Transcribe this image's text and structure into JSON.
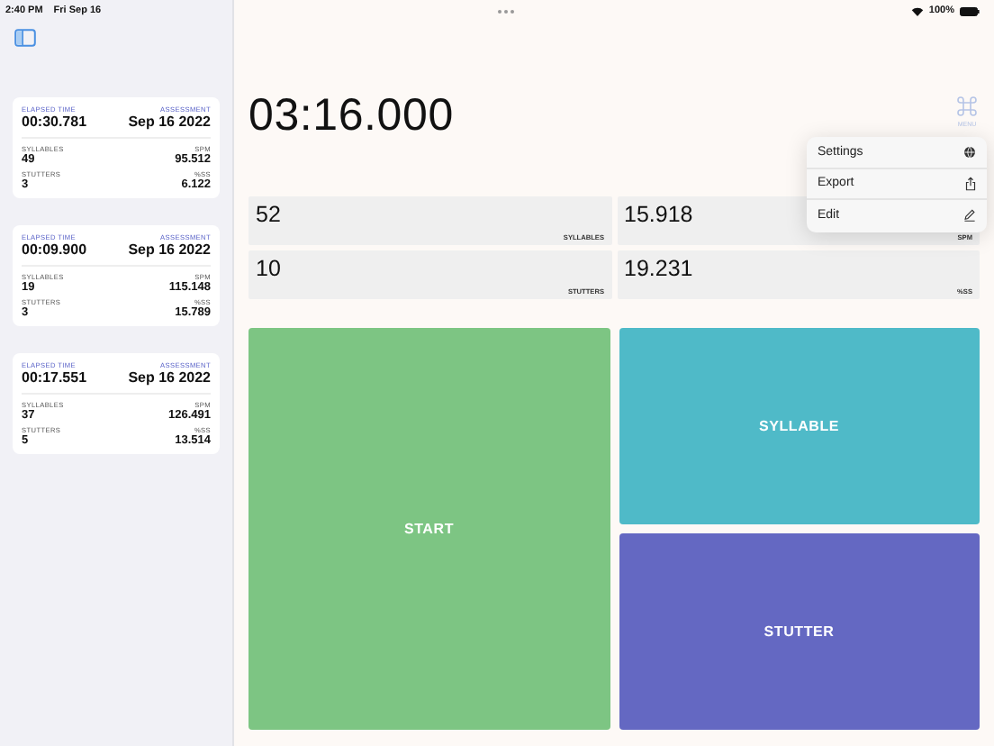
{
  "status_bar": {
    "time": "2:40 PM",
    "date": "Fri Sep 16",
    "battery": "100%"
  },
  "sessions": [
    {
      "elapsed_label": "ELAPSED TIME",
      "elapsed": "00:30.781",
      "assessment_label": "ASSESSMENT",
      "date": "Sep 16 2022",
      "syllables_label": "SYLLABLES",
      "syllables": "49",
      "spm_label": "SPM",
      "spm": "95.512",
      "stutters_label": "STUTTERS",
      "stutters": "3",
      "pss_label": "%SS",
      "pss": "6.122"
    },
    {
      "elapsed_label": "ELAPSED TIME",
      "elapsed": "00:09.900",
      "assessment_label": "ASSESSMENT",
      "date": "Sep 16 2022",
      "syllables_label": "SYLLABLES",
      "syllables": "19",
      "spm_label": "SPM",
      "spm": "115.148",
      "stutters_label": "STUTTERS",
      "stutters": "3",
      "pss_label": "%SS",
      "pss": "15.789"
    },
    {
      "elapsed_label": "ELAPSED TIME",
      "elapsed": "00:17.551",
      "assessment_label": "ASSESSMENT",
      "date": "Sep 16 2022",
      "syllables_label": "SYLLABLES",
      "syllables": "37",
      "spm_label": "SPM",
      "spm": "126.491",
      "stutters_label": "STUTTERS",
      "stutters": "5",
      "pss_label": "%SS",
      "pss": "13.514"
    }
  ],
  "timer": "03:16.000",
  "menu_button": {
    "label": "MENU"
  },
  "stats": [
    {
      "value": "52",
      "label": "SYLLABLES"
    },
    {
      "value": "15.918",
      "label": "SPM"
    },
    {
      "value": "10",
      "label": "STUTTERS"
    },
    {
      "value": "19.231",
      "label": "%SS"
    }
  ],
  "actions": [
    {
      "label": "START",
      "color": "#7dc583"
    },
    {
      "label": "SYLLABLE",
      "color": "#4fbac8"
    },
    {
      "label": "STUTTER",
      "color": "#6468c2"
    }
  ],
  "menu": [
    {
      "label": "Settings",
      "kind": "globe"
    },
    {
      "label": "Export",
      "kind": "share"
    },
    {
      "label": "Edit",
      "kind": "pencil"
    }
  ]
}
